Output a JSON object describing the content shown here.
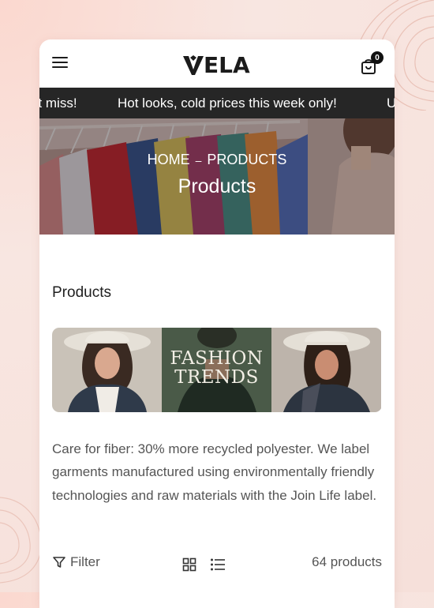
{
  "header": {
    "logo_text": "ELA",
    "cart_count": "0"
  },
  "announcement": {
    "items": [
      "Don't miss!",
      "Hot looks, cold prices this week only!",
      "Up"
    ]
  },
  "hero": {
    "breadcrumb_home": "HOME",
    "breadcrumb_separator": "–",
    "breadcrumb_current": "PRODUCTS",
    "title": "Products"
  },
  "collection": {
    "title": "Products",
    "banner_line1": "FASHION",
    "banner_line2": "TRENDS",
    "description": "Care for fiber: 30% more recycled polyester. We label garments manufactured using environmentally friendly technologies and raw materials with the Join Life label."
  },
  "toolbar": {
    "filter_label": "Filter",
    "product_count": "64 products"
  },
  "colors": {
    "announcement_bg": "#262626",
    "page_bg": "#f6e0da",
    "text_primary": "#1f1f1f",
    "text_secondary": "#555555"
  },
  "icons": [
    "hamburger-menu-icon",
    "cart-bag-icon",
    "filter-funnel-icon",
    "grid-view-icon",
    "list-view-icon"
  ]
}
